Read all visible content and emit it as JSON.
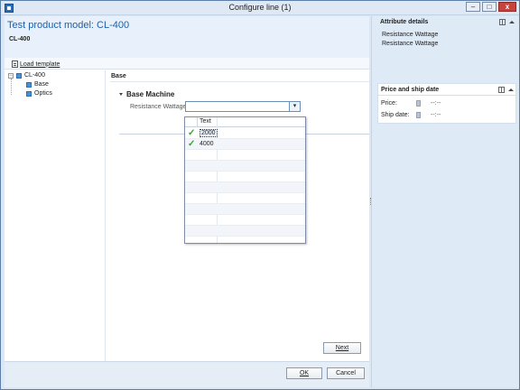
{
  "window": {
    "title": "Configure line (1)",
    "controls": {
      "minimize": "–",
      "maximize": "□",
      "close": "x"
    }
  },
  "header": {
    "title": "Test product model: CL-400",
    "subtitle": "CL-400"
  },
  "toolbar": {
    "load_template": "Load template"
  },
  "tree": {
    "root": {
      "label": "CL-400",
      "toggle": "−"
    },
    "children": [
      {
        "label": "Base"
      },
      {
        "label": "Optics"
      }
    ]
  },
  "content": {
    "section": "Base",
    "group": "Base Machine",
    "field_label": "Resistance Wattage:",
    "field_value": "",
    "dropdown_arrow": "▾"
  },
  "dropdown": {
    "column_header": "Text",
    "rows": [
      {
        "value": "2000",
        "check": "✓",
        "selected": true
      },
      {
        "value": "4000",
        "check": "✓",
        "selected": false
      }
    ]
  },
  "buttons": {
    "next": "Next",
    "ok": "OK",
    "cancel": "Cancel"
  },
  "attribute_details": {
    "title": "Attribute details",
    "lines": [
      "Resistance Wattage",
      "Resistance Wattage"
    ]
  },
  "price_ship": {
    "title": "Price and ship date",
    "price_label": "Price:",
    "price_value": "--:--",
    "ship_label": "Ship date:",
    "ship_value": "--:--"
  },
  "colors": {
    "title_blue": "#1f5fa8",
    "check_green": "#3aa236",
    "pane_bg": "#dfeaf7"
  }
}
